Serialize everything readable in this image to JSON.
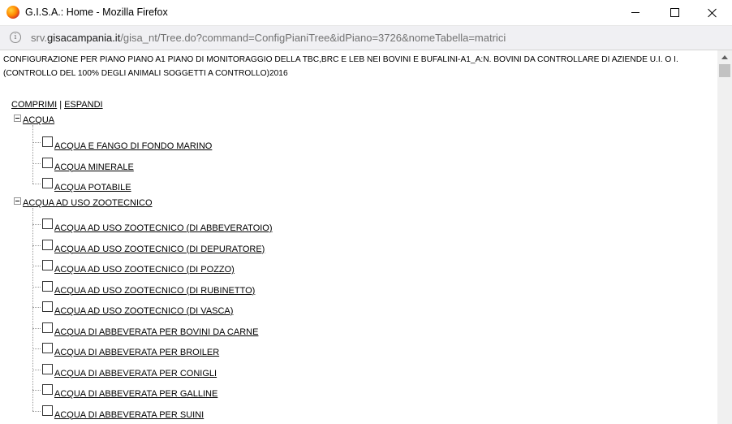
{
  "window": {
    "title": "G.I.S.A.: Home - Mozilla Firefox",
    "app_icon": "firefox-icon"
  },
  "urlbar": {
    "prefix": "srv.",
    "host": "gisacampania.it",
    "path": "/gisa_nt/Tree.do?command=ConfigPianiTree&idPiano=3726&nomeTabella=matrici"
  },
  "page": {
    "header_line1": "CONFIGURAZIONE PER PIANO PIANO A1 PIANO DI MONITORAGGIO DELLA TBC,BRC E LEB NEI BOVINI E BUFALINI-A1_A:N. BOVINI DA CONTROLLARE DI AZIENDE U.I. O I.",
    "header_line2": "(CONTROLLO DEL 100% DEGLI ANIMALI SOGGETTI A CONTROLLO)2016",
    "collapse_label": "COMPRIMI",
    "separator": "|",
    "expand_label": "ESPANDI"
  },
  "tree": [
    {
      "label": "ACQUA",
      "children": [
        "ACQUA E FANGO DI FONDO MARINO",
        "ACQUA MINERALE",
        "ACQUA POTABILE"
      ]
    },
    {
      "label": "ACQUA AD USO ZOOTECNICO",
      "children": [
        "ACQUA AD USO ZOOTECNICO (DI ABBEVERATOIO)",
        "ACQUA AD USO ZOOTECNICO (DI DEPURATORE)",
        "ACQUA AD USO ZOOTECNICO (DI POZZO)",
        "ACQUA AD USO ZOOTECNICO (DI RUBINETTO)",
        "ACQUA AD USO ZOOTECNICO (DI VASCA)",
        "ACQUA DI ABBEVERATA PER BOVINI DA CARNE",
        "ACQUA DI ABBEVERATA PER BROILER",
        "ACQUA DI ABBEVERATA PER CONIGLI",
        "ACQUA DI ABBEVERATA PER GALLINE",
        "ACQUA DI ABBEVERATA PER SUINI"
      ]
    }
  ]
}
